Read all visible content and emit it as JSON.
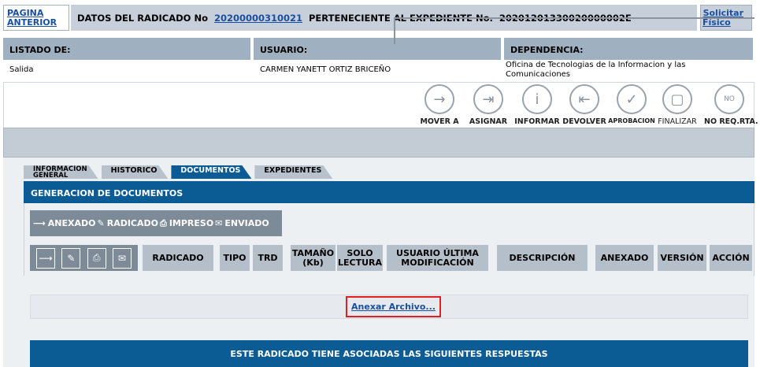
{
  "top": {
    "pagina_anterior": [
      "PAGINA",
      "ANTERIOR"
    ],
    "radicado_prefix": "DATOS DEL RADICADO No",
    "radicado_no": "20200000310021",
    "expediente_prefix": "PERTENECIENTE AL EXPEDIENTE No.",
    "expediente_no": "20201201330020000002E",
    "solicitar": [
      "Solicitar",
      "Físico"
    ]
  },
  "info": {
    "listado_label": "LISTADO DE:",
    "listado_value": "Salida",
    "usuario_label": "USUARIO:",
    "usuario_value": "CARMEN YANETT ORTIZ BRICEÑO",
    "dependencia_label": "DEPENDENCIA:",
    "dependencia_value_1": " Oficina de Tecnologias de la Informacion y las",
    "dependencia_value_2": "Comunicaciones"
  },
  "actions": [
    {
      "label": "MOVER A",
      "icon": "arrow-right-icon"
    },
    {
      "label": "ASIGNAR",
      "icon": "assign-icon"
    },
    {
      "label": "INFORMAR",
      "icon": "info-icon"
    },
    {
      "label": "DEVOLVER",
      "icon": "return-icon"
    },
    {
      "label": "APROBACION",
      "icon": "check-icon"
    },
    {
      "label": "FINALIZAR",
      "icon": "finish-icon"
    },
    {
      "label": "NO REQ.RTA.",
      "icon": "no-icon"
    }
  ],
  "tabs": [
    {
      "label_1": "INFORMACION",
      "label_2": "GENERAL"
    },
    {
      "label": "HISTORICO"
    },
    {
      "label": "DOCUMENTOS"
    },
    {
      "label": "EXPEDIENTES"
    }
  ],
  "gen": {
    "title": "GENERACION DE DOCUMENTOS",
    "legend": [
      "ANEXADO",
      "RADICADO",
      "IMPRESO",
      "ENVIADO"
    ],
    "columns": [
      "RADICADO",
      "TIPO",
      "TRD",
      "TAMAÑO",
      "(Kb)",
      "SOLO",
      "LECTURA",
      "USUARIO ÚLTIMA",
      "MODIFICACIÓN",
      "DESCRIPCIÓN",
      "ANEXADO",
      "VERSIÓN",
      "ACCIÓN"
    ],
    "anexar": "Anexar Archivo...",
    "respuestas": "ESTE RADICADO TIENE ASOCIADAS LAS SIGUIENTES RESPUESTAS"
  },
  "colors": {
    "primary": "#0b5c94",
    "header_gray": "#9fb0c0",
    "highlight": "#e02020"
  }
}
